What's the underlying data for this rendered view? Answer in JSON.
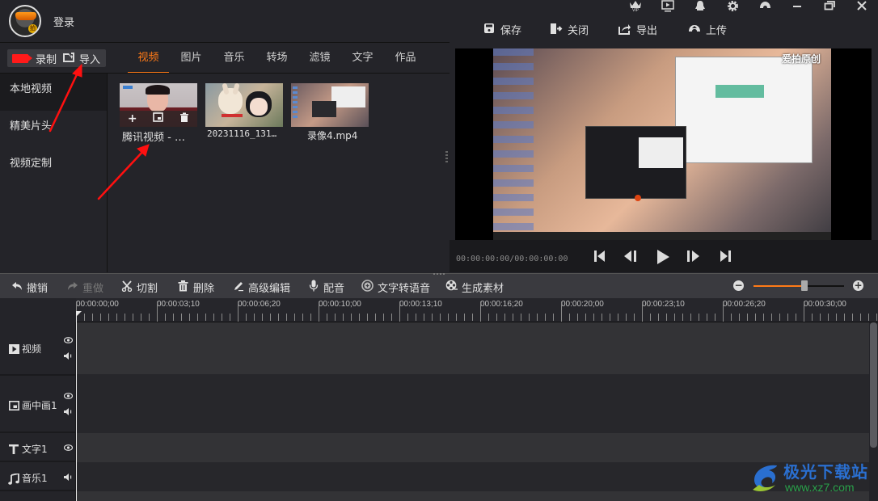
{
  "header": {
    "login_label": "登录",
    "window_icons": [
      "vip-crown-icon",
      "player-icon",
      "qq-icon",
      "settings-gear-icon",
      "skin-icon",
      "minimize-icon",
      "restore-icon",
      "close-icon"
    ],
    "actions": [
      {
        "label": "保存",
        "icon": "save-icon"
      },
      {
        "label": "关闭",
        "icon": "exit-icon"
      },
      {
        "label": "导出",
        "icon": "export-icon"
      },
      {
        "label": "上传",
        "icon": "upload-cloud-icon"
      }
    ]
  },
  "left_panel": {
    "record_label": "录制",
    "import_label": "导入",
    "tabs": [
      {
        "label": "视频",
        "active": true
      },
      {
        "label": "图片"
      },
      {
        "label": "音乐"
      },
      {
        "label": "转场"
      },
      {
        "label": "滤镜"
      },
      {
        "label": "文字"
      },
      {
        "label": "作品"
      }
    ],
    "sidebar": [
      {
        "label": "本地视频",
        "active": true
      },
      {
        "label": "精美片头"
      },
      {
        "label": "视频定制"
      }
    ],
    "media_items": [
      {
        "caption": "腾讯视频 - …",
        "overlay_actions": [
          "add-icon",
          "pip-icon",
          "trash-icon"
        ]
      },
      {
        "caption": "20231116_131…"
      },
      {
        "caption": "录像4.mp4"
      }
    ]
  },
  "preview": {
    "watermark_text": "爱拍原创",
    "timecode": "00:00:00:00/00:00:00:00",
    "controls": [
      "skip-to-start-icon",
      "step-back-icon",
      "play-icon",
      "step-forward-icon",
      "skip-to-end-icon"
    ]
  },
  "toolbar": {
    "items": [
      {
        "label": "撤销",
        "icon": "undo-icon",
        "enabled": true
      },
      {
        "label": "重做",
        "icon": "redo-icon",
        "enabled": false
      },
      {
        "label": "切割",
        "icon": "scissors-icon",
        "enabled": true
      },
      {
        "label": "删除",
        "icon": "trash-icon",
        "enabled": true
      },
      {
        "label": "高级编辑",
        "icon": "pencil-icon",
        "enabled": true
      },
      {
        "label": "配音",
        "icon": "microphone-icon",
        "enabled": true
      },
      {
        "label": "文字转语音",
        "icon": "tts-icon",
        "enabled": true
      },
      {
        "label": "生成素材",
        "icon": "film-reel-icon",
        "enabled": true
      }
    ],
    "zoom_level": 0.56
  },
  "timeline": {
    "ruler_labels": [
      "00:00:00;00",
      "00:00:03;10",
      "00:00:06;20",
      "00:00:10;00",
      "00:00:13;10",
      "00:00:16;20",
      "00:00:20;00",
      "00:00:23;10",
      "00:00:26;20",
      "00:00:30;00"
    ],
    "tracks": [
      {
        "name": "视频",
        "icon": "play-square-icon",
        "eye": true,
        "volume": true
      },
      {
        "name": "画中画1",
        "icon": "pip-icon",
        "eye": true,
        "volume": true
      },
      {
        "name": "文字1",
        "icon": "text-t-icon",
        "eye": true,
        "volume": false
      },
      {
        "name": "音乐1",
        "icon": "music-note-icon",
        "eye": false,
        "volume": true
      }
    ]
  },
  "watermark": {
    "brand": "极光下载站",
    "url": "www.xz7.com"
  }
}
